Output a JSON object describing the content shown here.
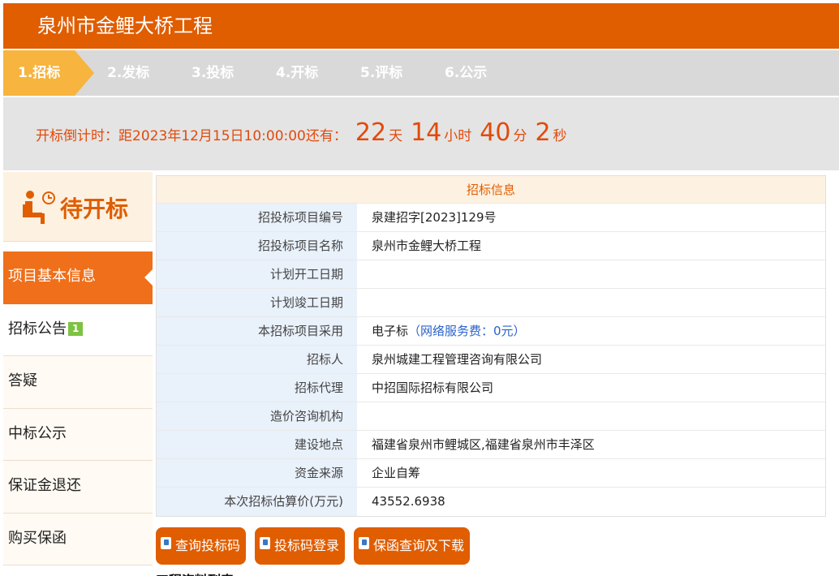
{
  "header": {
    "title": "泉州市金鲤大桥工程"
  },
  "steps": [
    {
      "label": "1.招标",
      "active": true
    },
    {
      "label": "2.发标"
    },
    {
      "label": "3.投标"
    },
    {
      "label": "4.开标"
    },
    {
      "label": "5.评标"
    },
    {
      "label": "6.公示"
    }
  ],
  "countdown": {
    "prefix": "开标倒计时：距2023年12月15日10:00:00还有：",
    "days": "22",
    "days_unit": "天",
    "hours": "14",
    "hours_unit": "小时",
    "minutes": "40",
    "minutes_unit": "分",
    "seconds": "2",
    "seconds_unit": "秒"
  },
  "status": {
    "label": "待开标",
    "icon": "person-waiting-clock-icon"
  },
  "menu": [
    {
      "label": "项目基本信息",
      "active": true
    },
    {
      "label": "招标公告",
      "badge": "1"
    },
    {
      "label": "答疑"
    },
    {
      "label": "中标公示"
    },
    {
      "label": "保证金退还"
    },
    {
      "label": "购买保函"
    }
  ],
  "info": {
    "title": "招标信息",
    "rows": [
      {
        "k": "招投标项目编号",
        "v": "泉建招字[2023]129号"
      },
      {
        "k": "招投标项目名称",
        "v": "泉州市金鲤大桥工程"
      },
      {
        "k": "计划开工日期",
        "v": ""
      },
      {
        "k": "计划竣工日期",
        "v": ""
      },
      {
        "k": "本招标项目采用",
        "v": "电子标",
        "note": "（网络服务费：0元）"
      },
      {
        "k": "招标人",
        "v": "泉州城建工程管理咨询有限公司"
      },
      {
        "k": "招标代理",
        "v": "中招国际招标有限公司"
      },
      {
        "k": "造价咨询机构",
        "v": ""
      },
      {
        "k": "建设地点",
        "v": "福建省泉州市鲤城区,福建省泉州市丰泽区"
      },
      {
        "k": "资金来源",
        "v": "企业自筹"
      },
      {
        "k": "本次招标估算价(万元)",
        "v": "43552.6938"
      }
    ]
  },
  "buttons": [
    {
      "label": "查询投标码"
    },
    {
      "label": "投标码登录"
    },
    {
      "label": "保函查询及下载"
    }
  ],
  "listing": {
    "title": "工程资料列表"
  },
  "colors": {
    "primary": "#e05d00",
    "step_active": "#f7b43e",
    "menu_active": "#ef6f1a",
    "countdown": "#e24a0a"
  }
}
